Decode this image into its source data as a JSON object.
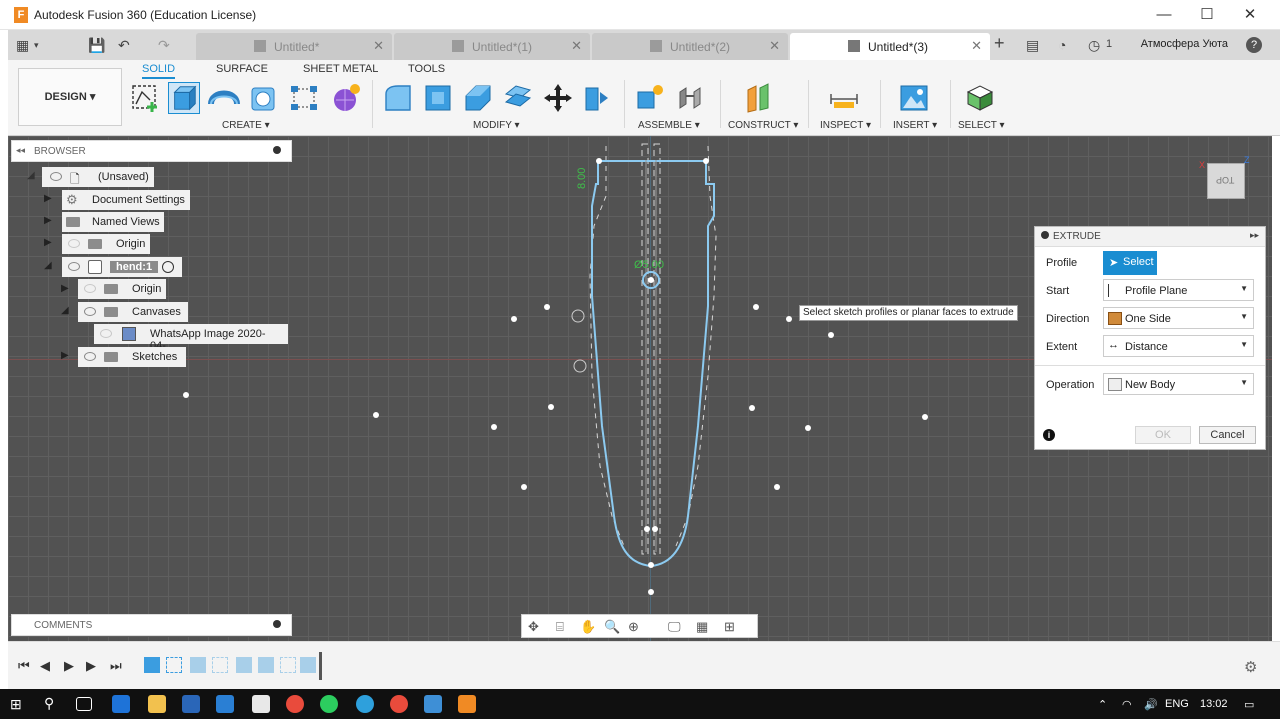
{
  "window": {
    "app_icon_letter": "F",
    "title": "Autodesk Fusion 360 (Education License)",
    "minimize": "—",
    "maximize": "☐",
    "close": "✕"
  },
  "tabs": [
    {
      "label": "Untitled*",
      "active": false
    },
    {
      "label": "Untitled*(1)",
      "active": false
    },
    {
      "label": "Untitled*(2)",
      "active": false
    },
    {
      "label": "Untitled*(3)",
      "active": true
    }
  ],
  "tab_close": "✕",
  "tab_add": "+",
  "header": {
    "job_status": "1",
    "user_name": "Атмосфера Уюта",
    "help": "?"
  },
  "ribbon": {
    "workspace": "DESIGN ▾",
    "tabs": [
      "SOLID",
      "SURFACE",
      "SHEET METAL",
      "TOOLS"
    ],
    "groups": [
      "CREATE ▾",
      "MODIFY ▾",
      "ASSEMBLE ▾",
      "CONSTRUCT ▾",
      "INSPECT ▾",
      "INSERT ▾",
      "SELECT ▾"
    ]
  },
  "browser": {
    "title": "BROWSER",
    "nodes": [
      {
        "label": "(Unsaved)"
      },
      {
        "label": "Document Settings"
      },
      {
        "label": "Named Views"
      },
      {
        "label": "Origin"
      },
      {
        "label": "hend:1"
      },
      {
        "label": "Origin"
      },
      {
        "label": "Canvases"
      },
      {
        "label": "WhatsApp Image 2020-04-..."
      },
      {
        "label": "Sketches"
      }
    ]
  },
  "comments": {
    "title": "COMMENTS"
  },
  "canvas": {
    "tooltip": "Select sketch profiles or planar faces to extrude",
    "dimension_top": "8.00",
    "dimension_mid": "Ø5.00",
    "viewcube_label": "TOP"
  },
  "extrude": {
    "title": "EXTRUDE",
    "profile_label": "Profile",
    "profile_button": "Select",
    "start_label": "Start",
    "start_value": "Profile Plane",
    "direction_label": "Direction",
    "direction_value": "One Side",
    "extent_label": "Extent",
    "extent_value": "Distance",
    "operation_label": "Operation",
    "operation_value": "New Body",
    "ok": "OK",
    "cancel": "Cancel"
  },
  "taskbar": {
    "language": "ENG",
    "time": "13:02"
  },
  "colors": {
    "accent": "#1a8dd1",
    "canvas_bg": "#525252",
    "sketch_profile": "#6ab7e8",
    "dimension_green": "#3fbf4a",
    "fusion_orange": "#f08a24"
  }
}
